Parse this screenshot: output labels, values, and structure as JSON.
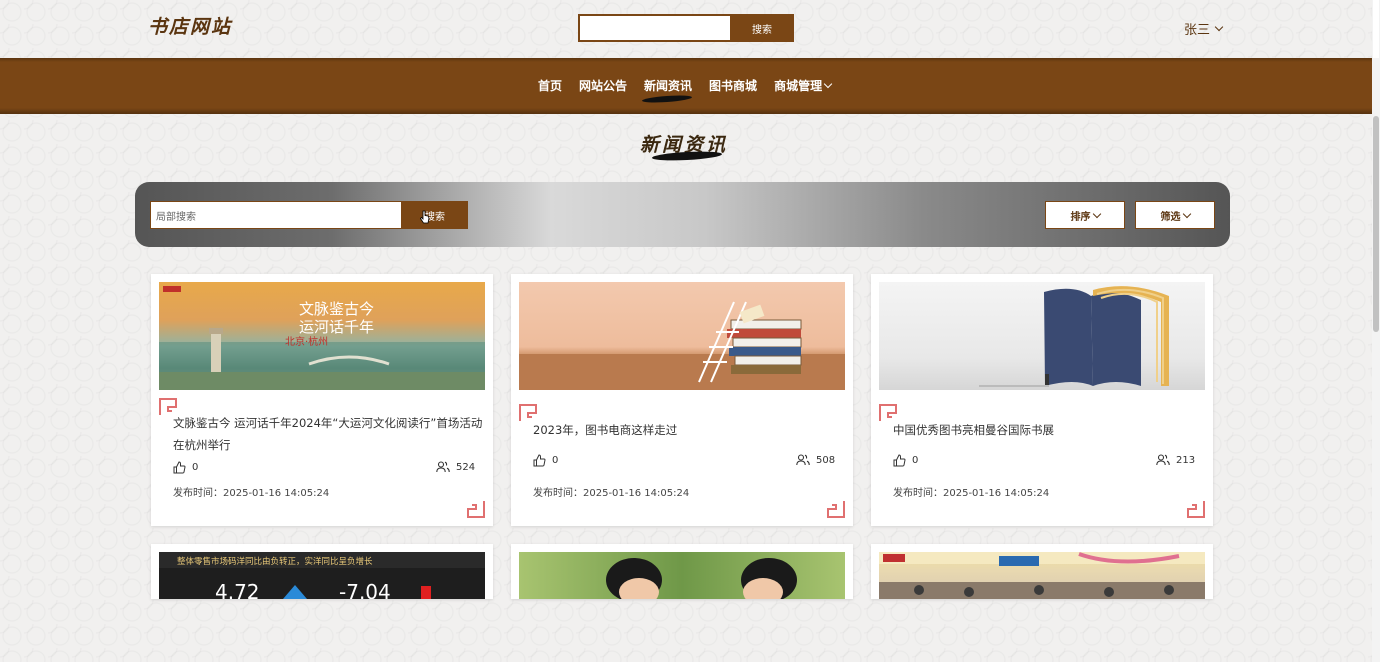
{
  "header": {
    "logo": "书店网站",
    "search_button": "搜索",
    "search_value": "",
    "user_name": "张三"
  },
  "nav": {
    "items": [
      {
        "label": "首页"
      },
      {
        "label": "网站公告"
      },
      {
        "label": "新闻资讯"
      },
      {
        "label": "图书商城"
      },
      {
        "label": "商城管理"
      }
    ],
    "active": "新闻资讯"
  },
  "page_title": "新闻资讯",
  "filter": {
    "search_placeholder": "局部搜索",
    "search_button": "搜索",
    "sort_label": "排序",
    "filter_label": "筛选"
  },
  "cards": [
    {
      "title": "文脉鉴古今 运河话千年2024年“大运河文化阅读行”首场活动在杭州举行",
      "likes": "0",
      "views": "524",
      "date_label": "发布时间：",
      "date": "2025-01-16 14:05:24",
      "image_text_1": "文脉鉴古今",
      "image_text_2": "运河话千年",
      "image_text_3": "北京·杭州"
    },
    {
      "title": "2023年，图书电商这样走过",
      "likes": "0",
      "views": "508",
      "date_label": "发布时间：",
      "date": "2025-01-16 14:05:24"
    },
    {
      "title": "中国优秀图书亮相曼谷国际书展",
      "likes": "0",
      "views": "213",
      "date_label": "发布时间：",
      "date": "2025-01-16 14:05:24"
    }
  ],
  "cards_row2": [
    {
      "image_text_1": "整体零售市场码洋同比由负转正，实洋同比呈负增长",
      "image_text_2": "4.72",
      "image_text_3": "-7.04"
    },
    {},
    {}
  ]
}
